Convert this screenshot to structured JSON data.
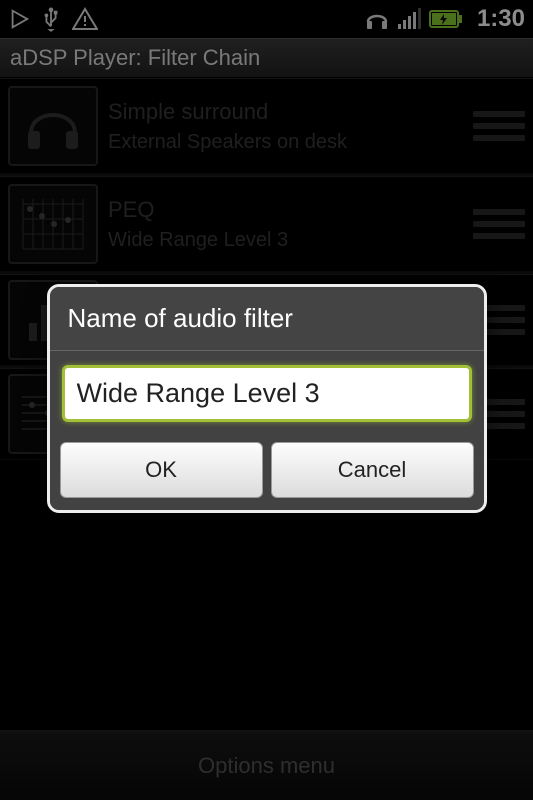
{
  "status": {
    "time": "1:30"
  },
  "app": {
    "title": "aDSP Player: Filter Chain"
  },
  "filters": [
    {
      "icon": "headphones-icon",
      "title": "Simple surround",
      "subtitle": "External Speakers on desk"
    },
    {
      "icon": "peq-icon",
      "title": "PEQ",
      "subtitle": "Wide Range Level 3"
    },
    {
      "icon": "eq-bars-icon",
      "title": "",
      "subtitle": ""
    },
    {
      "icon": "guitar-icon",
      "title": "",
      "subtitle": ""
    }
  ],
  "bottom": {
    "label": "Options menu"
  },
  "dialog": {
    "title": "Name of audio filter",
    "input_value": "Wide Range Level 3",
    "ok_label": "OK",
    "cancel_label": "Cancel"
  }
}
